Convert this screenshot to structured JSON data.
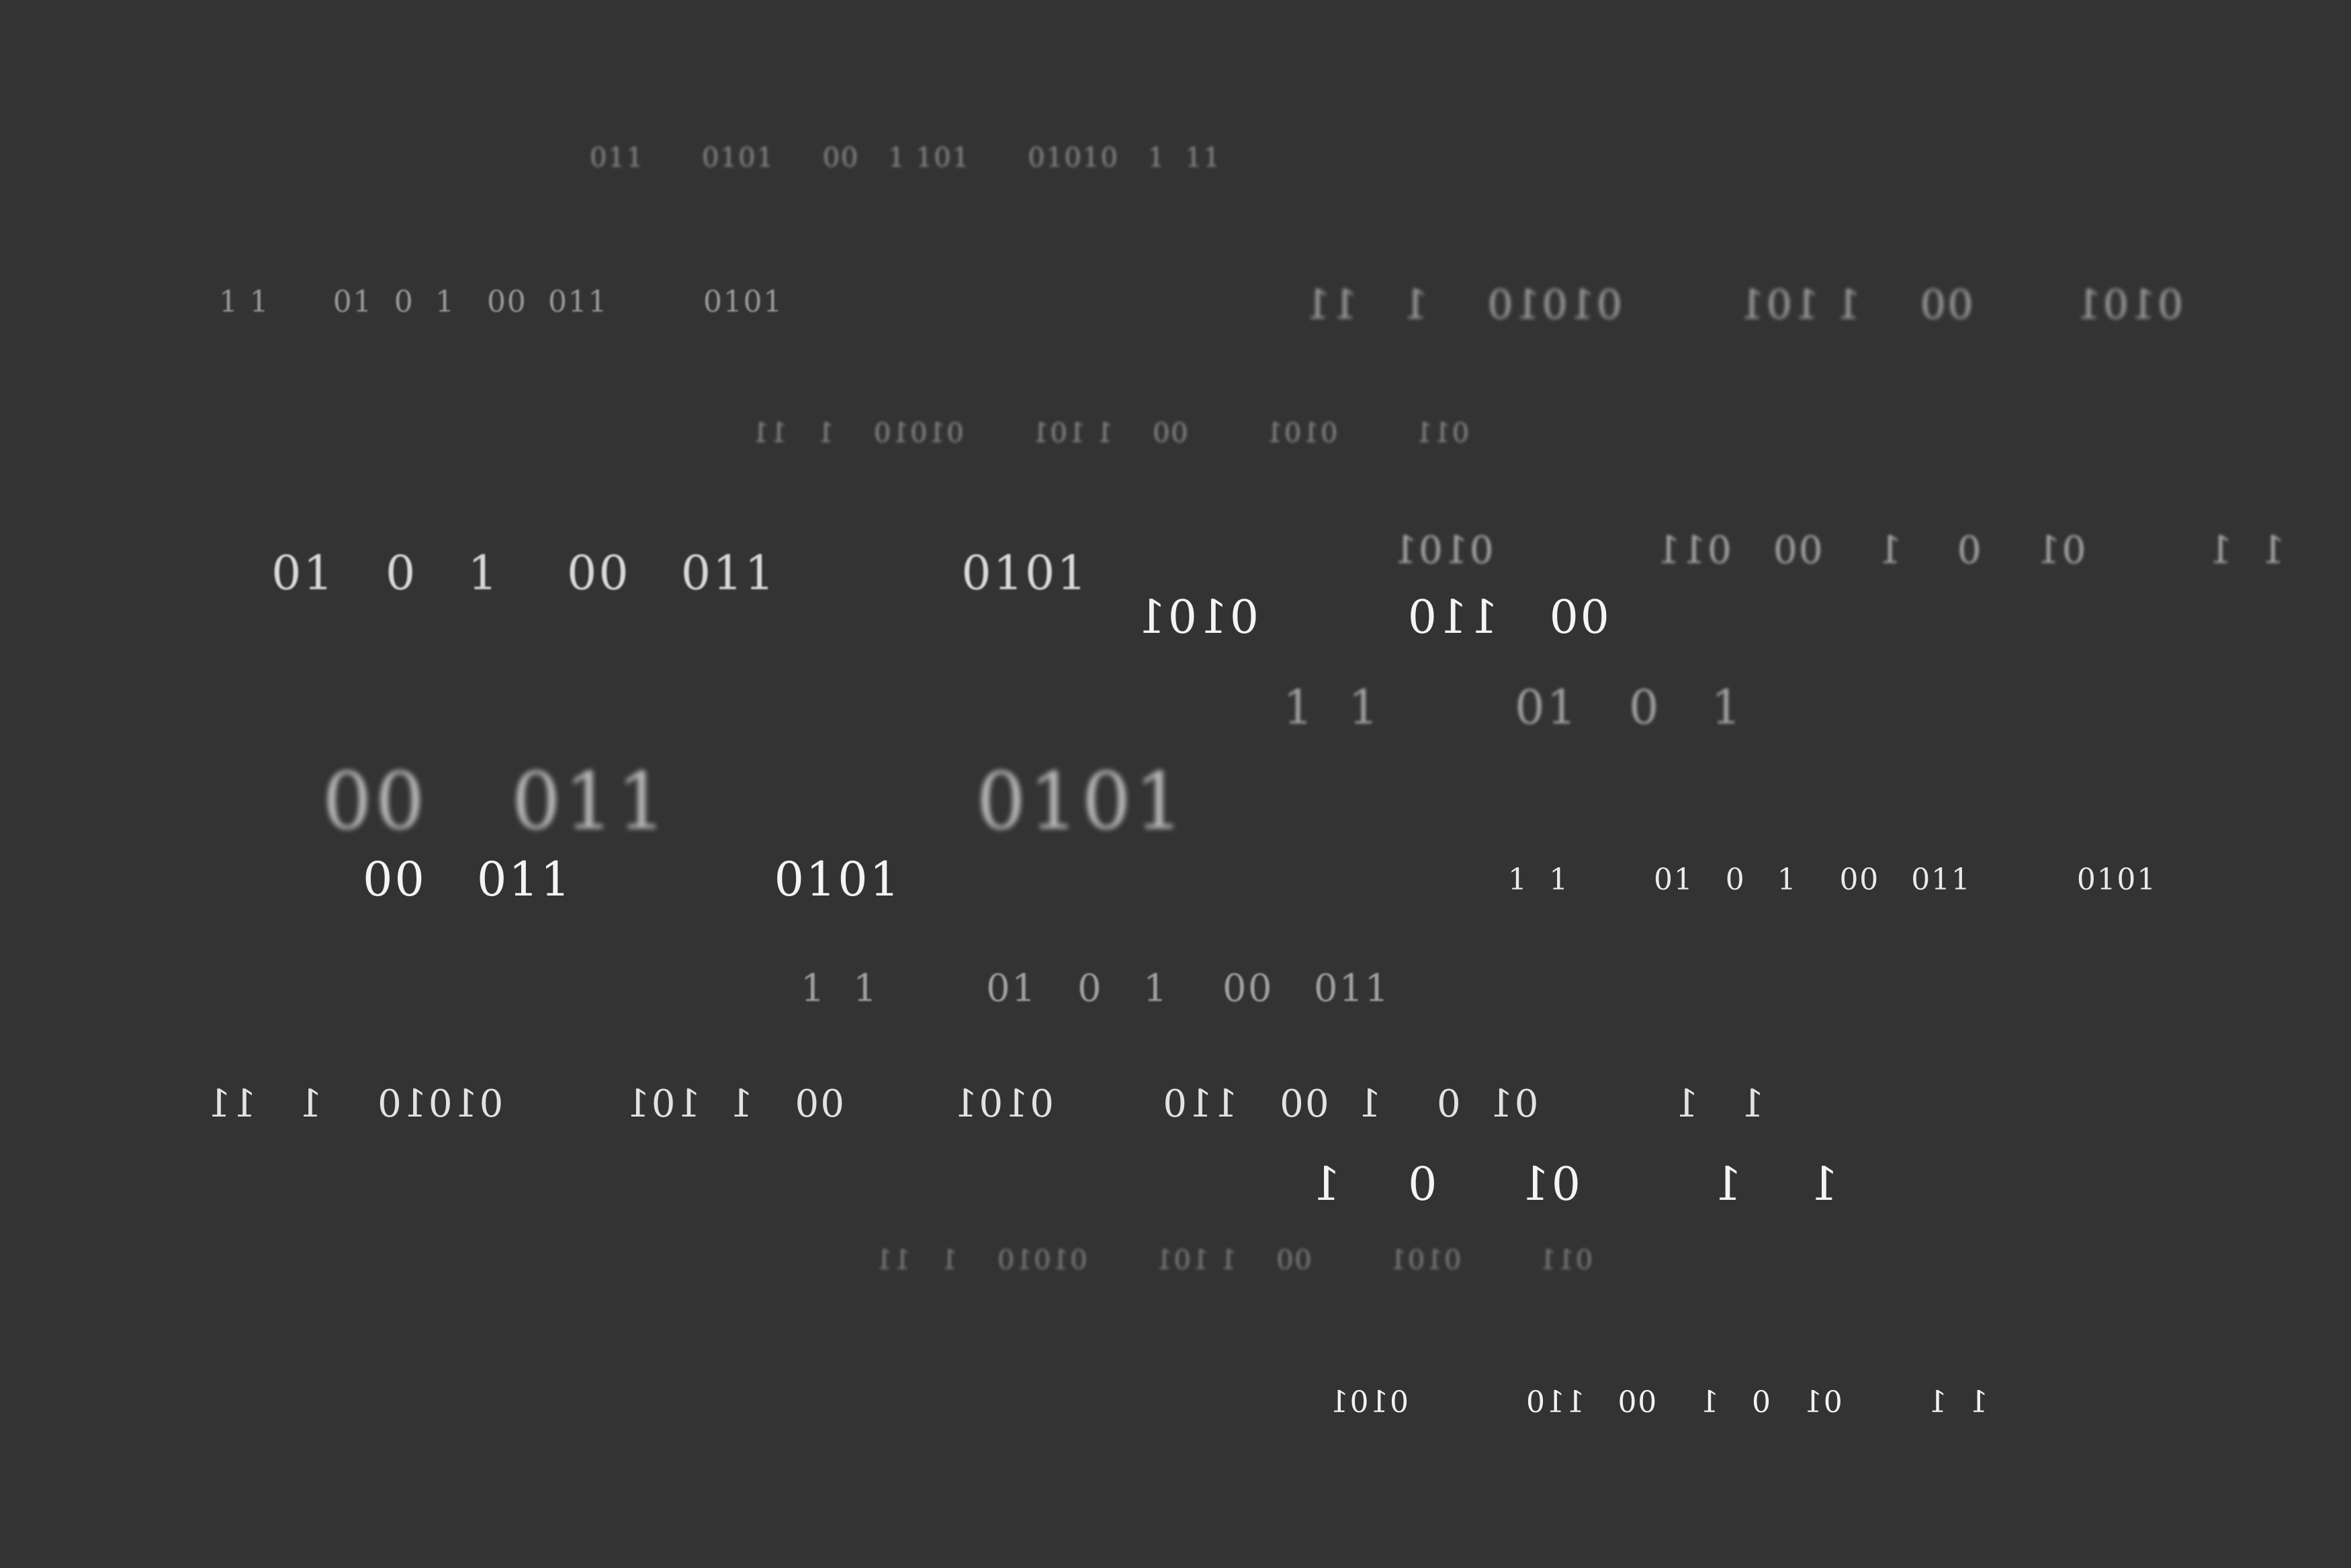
{
  "colors": {
    "background": "#333333",
    "text_bright": "#f2f2f2",
    "text_light": "#d0d0d0",
    "text_mid": "#a8a8a8",
    "text_dim": "#8a8a8a",
    "text_faint": "#6e6e6e"
  },
  "rows": {
    "r01": "011      0101     00   1 101      01010   1  11",
    "r02": "1 1      01  0  1   00  011         0101",
    "r03": "0101       00    1 101        01010    1   11",
    "r04": "011        0101        00    1 101       01010    1   11",
    "r05": "01   0   1    00   011           0101",
    "r06": "1  1         01    0    1    00   011            0101",
    "r07": "00   110         0101",
    "r08": "1  1        01   0   1",
    "r09": "00   011           0101",
    "r10": "00   011            0101",
    "r11": "1  1        01   0   1    00   011          0101",
    "r12": "1  1        01   0   1    00   011",
    "r13": "1   1          01  0    1  00   110        0101        00   1  101         01010    1   11",
    "r14": "1    1        01     0    1",
    "r15": "011        0101        00    1 101       01010    1   11",
    "r16": "1  1        01   0   1    00   110           0101"
  }
}
